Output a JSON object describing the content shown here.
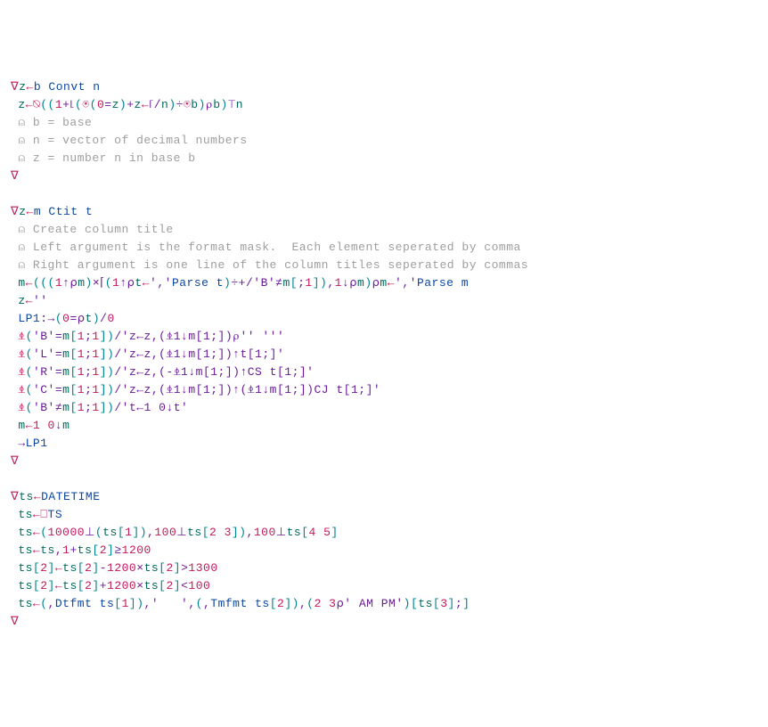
{
  "lines": [
    {
      "type": "code",
      "indent": 0,
      "spans": [
        {
          "c": "del",
          "t": "∇"
        },
        {
          "c": "var",
          "t": "z"
        },
        {
          "c": "arrow",
          "t": "←"
        },
        {
          "c": "kw",
          "t": "b Convt n"
        }
      ]
    },
    {
      "type": "code",
      "indent": 1,
      "spans": [
        {
          "c": "var",
          "t": "z"
        },
        {
          "c": "arrow",
          "t": "←"
        },
        {
          "c": "gly",
          "t": "⍉"
        },
        {
          "c": "paren",
          "t": "(("
        },
        {
          "c": "num",
          "t": "1"
        },
        {
          "c": "op",
          "t": "+⌊"
        },
        {
          "c": "paren",
          "t": "("
        },
        {
          "c": "gly",
          "t": "⍟"
        },
        {
          "c": "paren",
          "t": "("
        },
        {
          "c": "num",
          "t": "0"
        },
        {
          "c": "op",
          "t": "="
        },
        {
          "c": "var",
          "t": "z"
        },
        {
          "c": "paren",
          "t": ")"
        },
        {
          "c": "op",
          "t": "+"
        },
        {
          "c": "var",
          "t": "z"
        },
        {
          "c": "arrow",
          "t": "←"
        },
        {
          "c": "op",
          "t": "⌈/"
        },
        {
          "c": "var",
          "t": "n"
        },
        {
          "c": "paren",
          "t": ")"
        },
        {
          "c": "op",
          "t": "÷"
        },
        {
          "c": "gly",
          "t": "⍟"
        },
        {
          "c": "var",
          "t": "b"
        },
        {
          "c": "paren",
          "t": ")"
        },
        {
          "c": "op",
          "t": "⍴"
        },
        {
          "c": "var",
          "t": "b"
        },
        {
          "c": "paren",
          "t": ")"
        },
        {
          "c": "op",
          "t": "⊤"
        },
        {
          "c": "var",
          "t": "n"
        }
      ]
    },
    {
      "type": "cmt",
      "indent": 1,
      "spans": [
        {
          "c": "cmt",
          "t": "⍝ b = base"
        }
      ]
    },
    {
      "type": "cmt",
      "indent": 1,
      "spans": [
        {
          "c": "cmt",
          "t": "⍝ n = vector of decimal numbers"
        }
      ]
    },
    {
      "type": "cmt",
      "indent": 1,
      "spans": [
        {
          "c": "cmt",
          "t": "⍝ z = number n in base b"
        }
      ]
    },
    {
      "type": "code",
      "indent": 0,
      "spans": [
        {
          "c": "del",
          "t": "∇"
        }
      ]
    },
    {
      "type": "blank"
    },
    {
      "type": "code",
      "indent": 0,
      "spans": [
        {
          "c": "del",
          "t": "∇"
        },
        {
          "c": "var",
          "t": "z"
        },
        {
          "c": "arrow",
          "t": "←"
        },
        {
          "c": "kw",
          "t": "m Ctit t"
        }
      ]
    },
    {
      "type": "cmt",
      "indent": 1,
      "spans": [
        {
          "c": "cmt",
          "t": "⍝ Create column title"
        }
      ]
    },
    {
      "type": "cmt",
      "indent": 1,
      "spans": [
        {
          "c": "cmt",
          "t": "⍝ Left argument is the format mask.  Each element seperated by comma"
        }
      ]
    },
    {
      "type": "cmt",
      "indent": 1,
      "spans": [
        {
          "c": "cmt",
          "t": "⍝ Right argument is one line of the column titles seperated by commas"
        }
      ]
    },
    {
      "type": "code",
      "indent": 1,
      "spans": [
        {
          "c": "var",
          "t": "m"
        },
        {
          "c": "arrow",
          "t": "←"
        },
        {
          "c": "paren",
          "t": "((("
        },
        {
          "c": "num",
          "t": "1"
        },
        {
          "c": "op",
          "t": "↑⍴"
        },
        {
          "c": "var",
          "t": "m"
        },
        {
          "c": "paren",
          "t": ")"
        },
        {
          "c": "op",
          "t": "×⌈"
        },
        {
          "c": "paren",
          "t": "("
        },
        {
          "c": "num",
          "t": "1"
        },
        {
          "c": "op",
          "t": "↑⍴"
        },
        {
          "c": "var",
          "t": "t"
        },
        {
          "c": "arrow",
          "t": "←"
        },
        {
          "c": "str",
          "t": "','"
        },
        {
          "c": "kw",
          "t": "Parse t"
        },
        {
          "c": "paren",
          "t": ")"
        },
        {
          "c": "op",
          "t": "÷+/"
        },
        {
          "c": "str",
          "t": "'B'"
        },
        {
          "c": "op",
          "t": "≠"
        },
        {
          "c": "var",
          "t": "m"
        },
        {
          "c": "paren",
          "t": "["
        },
        {
          "c": "op",
          "t": ";"
        },
        {
          "c": "num",
          "t": "1"
        },
        {
          "c": "paren",
          "t": "])"
        },
        {
          "c": "op",
          "t": ","
        },
        {
          "c": "num",
          "t": "1"
        },
        {
          "c": "op",
          "t": "↓⍴"
        },
        {
          "c": "var",
          "t": "m"
        },
        {
          "c": "paren",
          "t": ")"
        },
        {
          "c": "op",
          "t": "⍴"
        },
        {
          "c": "var",
          "t": "m"
        },
        {
          "c": "arrow",
          "t": "←"
        },
        {
          "c": "str",
          "t": "','"
        },
        {
          "c": "kw",
          "t": "Parse m"
        }
      ]
    },
    {
      "type": "code",
      "indent": 1,
      "spans": [
        {
          "c": "var",
          "t": "z"
        },
        {
          "c": "arrow",
          "t": "←"
        },
        {
          "c": "str",
          "t": "''"
        }
      ]
    },
    {
      "type": "code",
      "indent": 1,
      "spans": [
        {
          "c": "kw",
          "t": "LP1"
        },
        {
          "c": "op",
          "t": ":→"
        },
        {
          "c": "paren",
          "t": "("
        },
        {
          "c": "num",
          "t": "0"
        },
        {
          "c": "op",
          "t": "=⍴"
        },
        {
          "c": "var",
          "t": "t"
        },
        {
          "c": "paren",
          "t": ")"
        },
        {
          "c": "op",
          "t": "/"
        },
        {
          "c": "num",
          "t": "0"
        }
      ]
    },
    {
      "type": "code",
      "indent": 1,
      "spans": [
        {
          "c": "gly",
          "t": "⍎"
        },
        {
          "c": "paren",
          "t": "("
        },
        {
          "c": "str",
          "t": "'B'"
        },
        {
          "c": "op",
          "t": "="
        },
        {
          "c": "var",
          "t": "m"
        },
        {
          "c": "paren",
          "t": "["
        },
        {
          "c": "num",
          "t": "1"
        },
        {
          "c": "op",
          "t": ";"
        },
        {
          "c": "num",
          "t": "1"
        },
        {
          "c": "paren",
          "t": "])"
        },
        {
          "c": "op",
          "t": "/"
        },
        {
          "c": "str",
          "t": "'z←z,(⍎1↓m[1;])⍴'' '''"
        }
      ]
    },
    {
      "type": "code",
      "indent": 1,
      "spans": [
        {
          "c": "gly",
          "t": "⍎"
        },
        {
          "c": "paren",
          "t": "("
        },
        {
          "c": "str",
          "t": "'L'"
        },
        {
          "c": "op",
          "t": "="
        },
        {
          "c": "var",
          "t": "m"
        },
        {
          "c": "paren",
          "t": "["
        },
        {
          "c": "num",
          "t": "1"
        },
        {
          "c": "op",
          "t": ";"
        },
        {
          "c": "num",
          "t": "1"
        },
        {
          "c": "paren",
          "t": "])"
        },
        {
          "c": "op",
          "t": "/"
        },
        {
          "c": "str",
          "t": "'z←z,(⍎1↓m[1;])↑t[1;]'"
        }
      ]
    },
    {
      "type": "code",
      "indent": 1,
      "spans": [
        {
          "c": "gly",
          "t": "⍎"
        },
        {
          "c": "paren",
          "t": "("
        },
        {
          "c": "str",
          "t": "'R'"
        },
        {
          "c": "op",
          "t": "="
        },
        {
          "c": "var",
          "t": "m"
        },
        {
          "c": "paren",
          "t": "["
        },
        {
          "c": "num",
          "t": "1"
        },
        {
          "c": "op",
          "t": ";"
        },
        {
          "c": "num",
          "t": "1"
        },
        {
          "c": "paren",
          "t": "])"
        },
        {
          "c": "op",
          "t": "/"
        },
        {
          "c": "str",
          "t": "'z←z,(-⍎1↓m[1;])↑CS t[1;]'"
        }
      ]
    },
    {
      "type": "code",
      "indent": 1,
      "spans": [
        {
          "c": "gly",
          "t": "⍎"
        },
        {
          "c": "paren",
          "t": "("
        },
        {
          "c": "str",
          "t": "'C'"
        },
        {
          "c": "op",
          "t": "="
        },
        {
          "c": "var",
          "t": "m"
        },
        {
          "c": "paren",
          "t": "["
        },
        {
          "c": "num",
          "t": "1"
        },
        {
          "c": "op",
          "t": ";"
        },
        {
          "c": "num",
          "t": "1"
        },
        {
          "c": "paren",
          "t": "])"
        },
        {
          "c": "op",
          "t": "/"
        },
        {
          "c": "str",
          "t": "'z←z,(⍎1↓m[1;])↑(⍎1↓m[1;])CJ t[1;]'"
        }
      ]
    },
    {
      "type": "code",
      "indent": 1,
      "spans": [
        {
          "c": "gly",
          "t": "⍎"
        },
        {
          "c": "paren",
          "t": "("
        },
        {
          "c": "str",
          "t": "'B'"
        },
        {
          "c": "op",
          "t": "≠"
        },
        {
          "c": "var",
          "t": "m"
        },
        {
          "c": "paren",
          "t": "["
        },
        {
          "c": "num",
          "t": "1"
        },
        {
          "c": "op",
          "t": ";"
        },
        {
          "c": "num",
          "t": "1"
        },
        {
          "c": "paren",
          "t": "])"
        },
        {
          "c": "op",
          "t": "/"
        },
        {
          "c": "str",
          "t": "'t←1 0↓t'"
        }
      ]
    },
    {
      "type": "code",
      "indent": 1,
      "spans": [
        {
          "c": "var",
          "t": "m"
        },
        {
          "c": "arrow",
          "t": "←"
        },
        {
          "c": "num",
          "t": "1 0"
        },
        {
          "c": "op",
          "t": "↓"
        },
        {
          "c": "var",
          "t": "m"
        }
      ]
    },
    {
      "type": "code",
      "indent": 1,
      "spans": [
        {
          "c": "op",
          "t": "→"
        },
        {
          "c": "kw",
          "t": "LP1"
        }
      ]
    },
    {
      "type": "code",
      "indent": 0,
      "spans": [
        {
          "c": "del",
          "t": "∇"
        }
      ]
    },
    {
      "type": "blank"
    },
    {
      "type": "code",
      "indent": 0,
      "spans": [
        {
          "c": "del",
          "t": "∇"
        },
        {
          "c": "var",
          "t": "ts"
        },
        {
          "c": "arrow",
          "t": "←"
        },
        {
          "c": "kw",
          "t": "DATETIME"
        }
      ]
    },
    {
      "type": "code",
      "indent": 1,
      "spans": [
        {
          "c": "var",
          "t": "ts"
        },
        {
          "c": "arrow",
          "t": "←"
        },
        {
          "c": "gly",
          "t": "⎕"
        },
        {
          "c": "kw",
          "t": "TS"
        }
      ]
    },
    {
      "type": "code",
      "indent": 1,
      "spans": [
        {
          "c": "var",
          "t": "ts"
        },
        {
          "c": "arrow",
          "t": "←"
        },
        {
          "c": "paren",
          "t": "("
        },
        {
          "c": "num",
          "t": "10000"
        },
        {
          "c": "op",
          "t": "⊥"
        },
        {
          "c": "paren",
          "t": "("
        },
        {
          "c": "var",
          "t": "ts"
        },
        {
          "c": "paren",
          "t": "["
        },
        {
          "c": "num",
          "t": "1"
        },
        {
          "c": "paren",
          "t": "])"
        },
        {
          "c": "op",
          "t": ","
        },
        {
          "c": "num",
          "t": "100"
        },
        {
          "c": "op",
          "t": "⊥"
        },
        {
          "c": "var",
          "t": "ts"
        },
        {
          "c": "paren",
          "t": "["
        },
        {
          "c": "num",
          "t": "2 3"
        },
        {
          "c": "paren",
          "t": "])"
        },
        {
          "c": "op",
          "t": ","
        },
        {
          "c": "num",
          "t": "100"
        },
        {
          "c": "op",
          "t": "⊥"
        },
        {
          "c": "var",
          "t": "ts"
        },
        {
          "c": "paren",
          "t": "["
        },
        {
          "c": "num",
          "t": "4 5"
        },
        {
          "c": "paren",
          "t": "]"
        }
      ]
    },
    {
      "type": "code",
      "indent": 1,
      "spans": [
        {
          "c": "var",
          "t": "ts"
        },
        {
          "c": "arrow",
          "t": "←"
        },
        {
          "c": "var",
          "t": "ts"
        },
        {
          "c": "op",
          "t": ","
        },
        {
          "c": "num",
          "t": "1"
        },
        {
          "c": "op",
          "t": "+"
        },
        {
          "c": "var",
          "t": "ts"
        },
        {
          "c": "paren",
          "t": "["
        },
        {
          "c": "num",
          "t": "2"
        },
        {
          "c": "paren",
          "t": "]"
        },
        {
          "c": "op",
          "t": "≥"
        },
        {
          "c": "num",
          "t": "1200"
        }
      ]
    },
    {
      "type": "code",
      "indent": 1,
      "spans": [
        {
          "c": "var",
          "t": "ts"
        },
        {
          "c": "paren",
          "t": "["
        },
        {
          "c": "num",
          "t": "2"
        },
        {
          "c": "paren",
          "t": "]"
        },
        {
          "c": "arrow",
          "t": "←"
        },
        {
          "c": "var",
          "t": "ts"
        },
        {
          "c": "paren",
          "t": "["
        },
        {
          "c": "num",
          "t": "2"
        },
        {
          "c": "paren",
          "t": "]"
        },
        {
          "c": "op",
          "t": "-"
        },
        {
          "c": "num",
          "t": "1200"
        },
        {
          "c": "op",
          "t": "×"
        },
        {
          "c": "var",
          "t": "ts"
        },
        {
          "c": "paren",
          "t": "["
        },
        {
          "c": "num",
          "t": "2"
        },
        {
          "c": "paren",
          "t": "]"
        },
        {
          "c": "op",
          "t": ">"
        },
        {
          "c": "num",
          "t": "1300"
        }
      ]
    },
    {
      "type": "code",
      "indent": 1,
      "spans": [
        {
          "c": "var",
          "t": "ts"
        },
        {
          "c": "paren",
          "t": "["
        },
        {
          "c": "num",
          "t": "2"
        },
        {
          "c": "paren",
          "t": "]"
        },
        {
          "c": "arrow",
          "t": "←"
        },
        {
          "c": "var",
          "t": "ts"
        },
        {
          "c": "paren",
          "t": "["
        },
        {
          "c": "num",
          "t": "2"
        },
        {
          "c": "paren",
          "t": "]"
        },
        {
          "c": "op",
          "t": "+"
        },
        {
          "c": "num",
          "t": "1200"
        },
        {
          "c": "op",
          "t": "×"
        },
        {
          "c": "var",
          "t": "ts"
        },
        {
          "c": "paren",
          "t": "["
        },
        {
          "c": "num",
          "t": "2"
        },
        {
          "c": "paren",
          "t": "]"
        },
        {
          "c": "op",
          "t": "<"
        },
        {
          "c": "num",
          "t": "100"
        }
      ]
    },
    {
      "type": "code",
      "indent": 1,
      "spans": [
        {
          "c": "var",
          "t": "ts"
        },
        {
          "c": "arrow",
          "t": "←"
        },
        {
          "c": "paren",
          "t": "("
        },
        {
          "c": "op",
          "t": ","
        },
        {
          "c": "kw",
          "t": "Dtfmt ts"
        },
        {
          "c": "paren",
          "t": "["
        },
        {
          "c": "num",
          "t": "1"
        },
        {
          "c": "paren",
          "t": "])"
        },
        {
          "c": "op",
          "t": ","
        },
        {
          "c": "str",
          "t": "'   '"
        },
        {
          "c": "op",
          "t": ","
        },
        {
          "c": "paren",
          "t": "("
        },
        {
          "c": "op",
          "t": ","
        },
        {
          "c": "kw",
          "t": "Tmfmt ts"
        },
        {
          "c": "paren",
          "t": "["
        },
        {
          "c": "num",
          "t": "2"
        },
        {
          "c": "paren",
          "t": "])"
        },
        {
          "c": "op",
          "t": ","
        },
        {
          "c": "paren",
          "t": "("
        },
        {
          "c": "num",
          "t": "2 3"
        },
        {
          "c": "op",
          "t": "⍴"
        },
        {
          "c": "str",
          "t": "' AM PM'"
        },
        {
          "c": "paren",
          "t": ")["
        },
        {
          "c": "var",
          "t": "ts"
        },
        {
          "c": "paren",
          "t": "["
        },
        {
          "c": "num",
          "t": "3"
        },
        {
          "c": "paren",
          "t": "]"
        },
        {
          "c": "op",
          "t": ";"
        },
        {
          "c": "paren",
          "t": "]"
        }
      ]
    },
    {
      "type": "code",
      "indent": 0,
      "spans": [
        {
          "c": "del",
          "t": "∇"
        }
      ]
    }
  ]
}
